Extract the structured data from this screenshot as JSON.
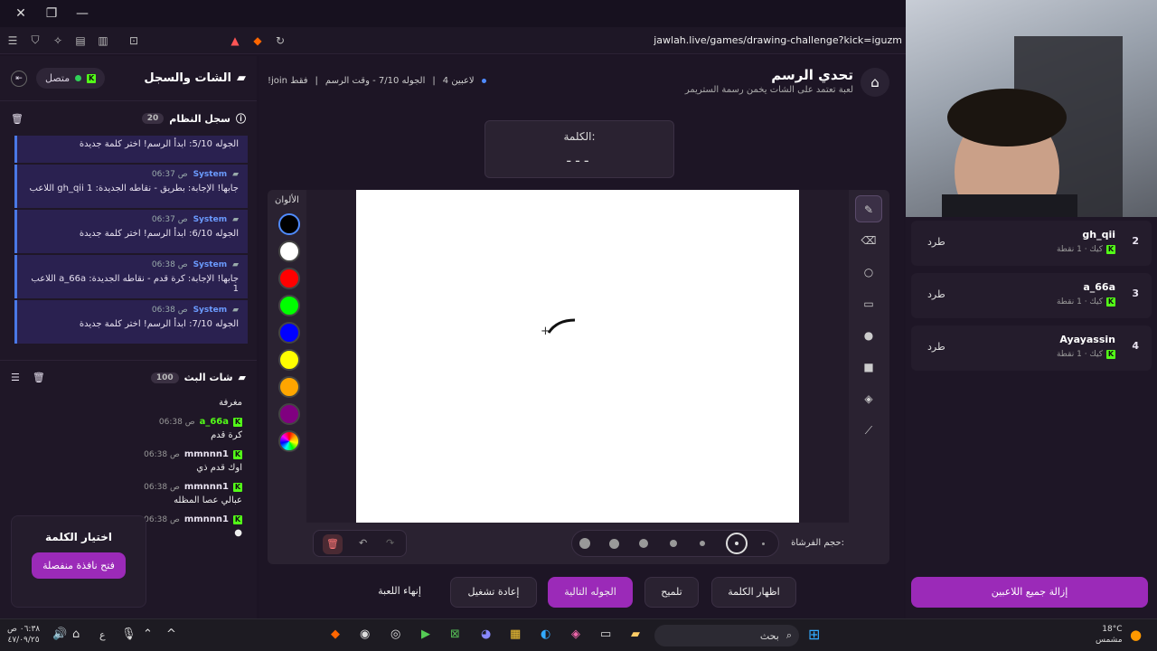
{
  "browser": {
    "url": "jawlah.live/games/drawing-challenge?kick=iguzm"
  },
  "left": {
    "title": "الشات والسجل",
    "status": "متصل",
    "system_log": {
      "title": "سجل النظام",
      "count": "20",
      "items": [
        {
          "sender": "",
          "time": "",
          "text": "الجوله 5/10: ابدأ الرسم! اختر كلمة جديدة"
        },
        {
          "sender": "System",
          "time": "06:37 ص",
          "text": "اللاعب gh_qii جابها! الإجابة: بطريق - نقاطه الجديدة: 1"
        },
        {
          "sender": "System",
          "time": "06:37 ص",
          "text": "الجوله 6/10: ابدأ الرسم! اختر كلمة جديدة"
        },
        {
          "sender": "System",
          "time": "06:38 ص",
          "text": "اللاعب a_66a جابها! الإجابة: كرة قدم - نقاطه الجديدة: 1"
        },
        {
          "sender": "System",
          "time": "06:38 ص",
          "text": "الجوله 7/10: ابدأ الرسم! اختر كلمة جديدة"
        }
      ]
    },
    "stream_chat": {
      "title": "شات البث",
      "count": "100",
      "messages": [
        {
          "user": "",
          "time": "",
          "text": "مغرفة"
        },
        {
          "user": "a_66a",
          "time": "06:38 ص",
          "text": "كرة قدم"
        },
        {
          "user": "mmnnn1",
          "time": "06:38 ص",
          "text": "اوك قدم ذي"
        },
        {
          "user": "mmnnn1",
          "time": "06:38 ص",
          "text": "عبالي عصا المظله"
        },
        {
          "user": "mmnnn1",
          "time": "06:38 ص",
          "text": ""
        }
      ]
    },
    "word_select": {
      "title": "اختيار الكلمة",
      "button": "فتح نافذة منفصلة"
    }
  },
  "main": {
    "title": "تحدي الرسم",
    "subtitle": "لعبة تعتمد على الشات يخمن رسمة الستريمر",
    "players": "4 لاعبين",
    "round": "الجوله 7/10 - وقت الرسم",
    "join": "!join فقط",
    "word_label": "الكلمة:",
    "word_mask": "---",
    "colors_label": "الألوان",
    "brush_label": "حجم الفرشاة:",
    "actions": [
      "إنهاء اللعبة",
      "إعادة تشغيل",
      "الجوله التالية",
      "تلميح",
      "اظهار الكلمة"
    ]
  },
  "right": {
    "players": [
      {
        "rank": "2",
        "name": "gh_qii",
        "sub": "كيك · 1 نقطة",
        "kick": "طرد"
      },
      {
        "rank": "3",
        "name": "a_66a",
        "sub": "كيك · 1 نقطة",
        "kick": "طرد"
      },
      {
        "rank": "4",
        "name": "Ayayassin",
        "sub": "كيك · 1 نقطة",
        "kick": "طرد"
      }
    ],
    "remove_all": "إزالة جميع اللاعبين"
  },
  "taskbar": {
    "search": "بحث",
    "temp": "18°C",
    "weather": "مشمس",
    "time": "٠٦:٣٨ ص",
    "date": "٤٧/٠٩/٢٥",
    "lang": "ع"
  },
  "colors": [
    "#000000",
    "#ffffff",
    "#ff0000",
    "#00ff00",
    "#0000ff",
    "#ffff00",
    "#ffa500",
    "#800080"
  ]
}
